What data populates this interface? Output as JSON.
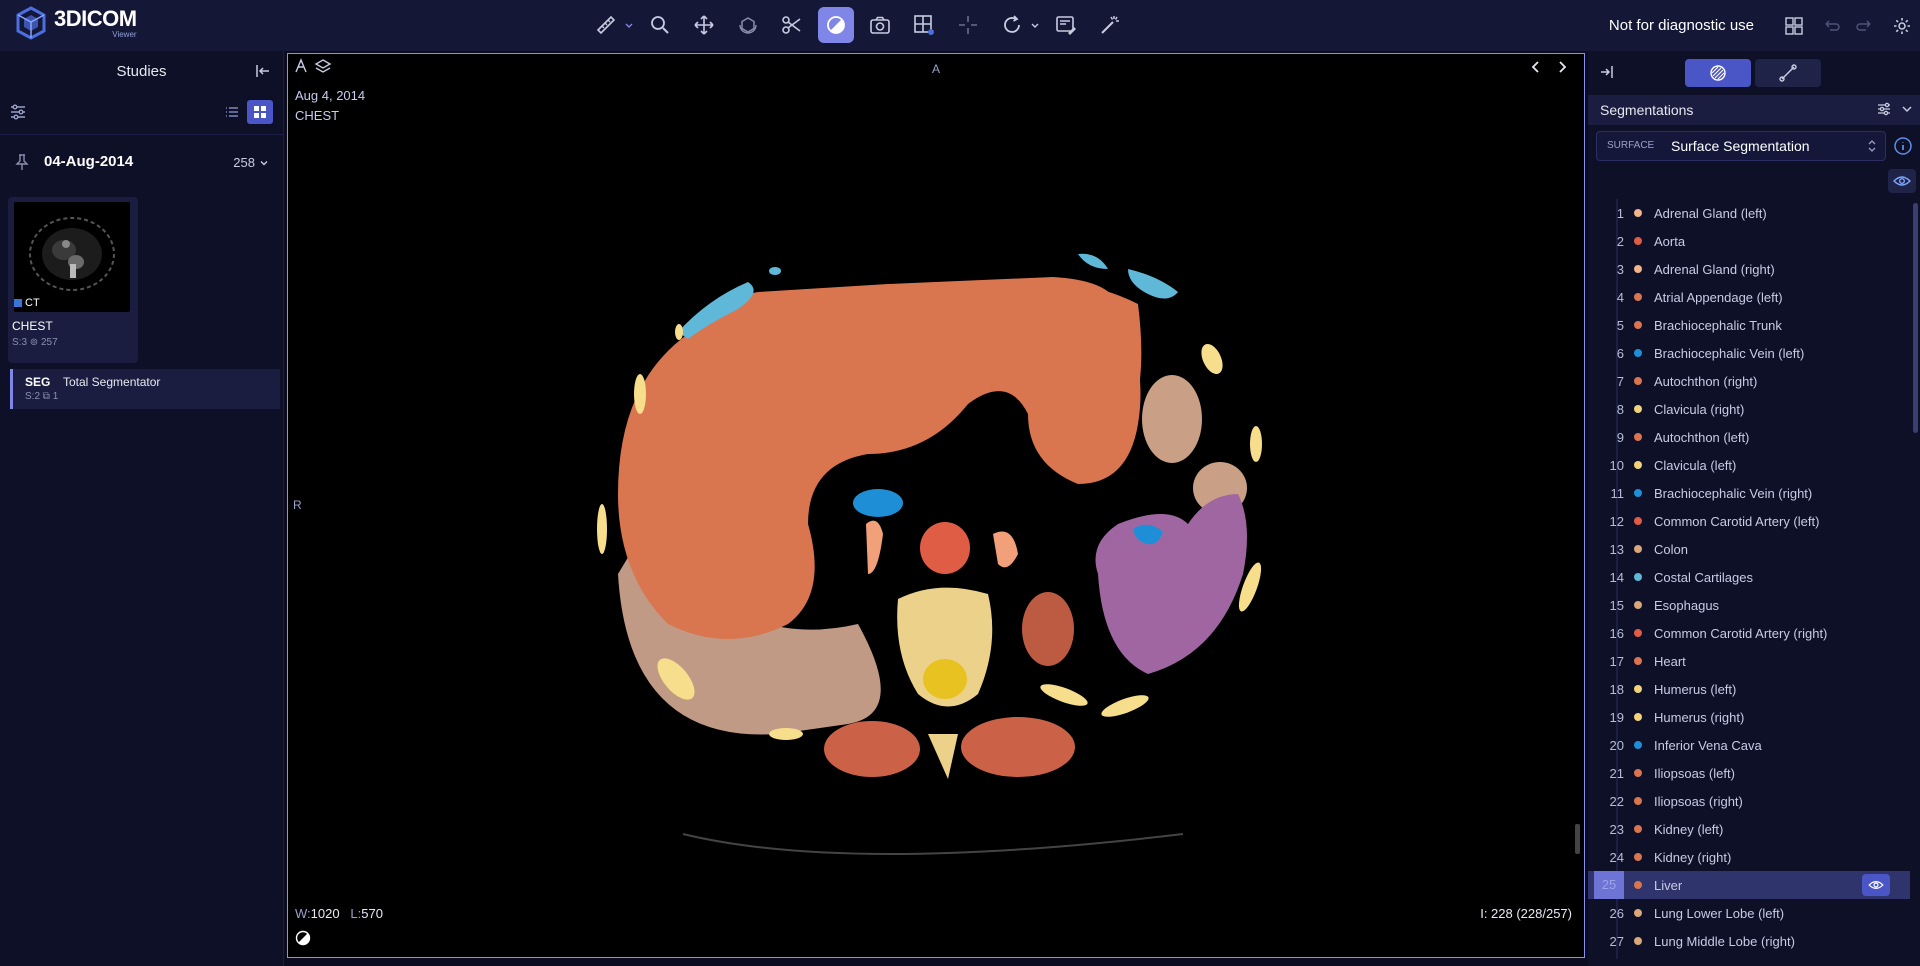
{
  "app": {
    "logo_name": "3DICOM",
    "logo_sub": "Viewer",
    "disclaimer": "Not for diagnostic use"
  },
  "toolbar": {
    "tools": [
      "ruler-tool",
      "zoom-tool",
      "pan-tool",
      "rotate-3d-tool",
      "scissors-tool",
      "segmentation-brush-tool",
      "screenshot-tool",
      "layout-tool",
      "crosshair-tool",
      "reset-rotate-tool",
      "report-tool",
      "magic-tool"
    ],
    "active_tool": "segmentation-brush-tool"
  },
  "studies": {
    "title": "Studies",
    "date": "04-Aug-2014",
    "image_count": "258",
    "series": {
      "modality": "CT",
      "name": "CHEST",
      "series_count": "S:3",
      "instances": "257"
    },
    "seg": {
      "tag": "SEG",
      "name": "Total Segmentator",
      "series_count": "S:2",
      "instances": "1"
    }
  },
  "viewport": {
    "date": "Aug 4, 2014",
    "description": "CHEST",
    "orient_top": "A",
    "orient_left": "R",
    "window_label": "W:",
    "window_value": "1020",
    "level_label": "L:",
    "level_value": "570",
    "image_index": "I: 228 (228/257)"
  },
  "segmentation_panel": {
    "title": "Segmentations",
    "type_tag": "SURFACE",
    "selected_segmentation": "Surface Segmentation",
    "selected_index": 25,
    "items": [
      {
        "num": "1",
        "name": "Adrenal Gland (left)",
        "color": "#f2b48a"
      },
      {
        "num": "2",
        "name": "Aorta",
        "color": "#e05d45"
      },
      {
        "num": "3",
        "name": "Adrenal Gland (right)",
        "color": "#f2b48a"
      },
      {
        "num": "4",
        "name": "Atrial Appendage (left)",
        "color": "#d9764f"
      },
      {
        "num": "5",
        "name": "Brachiocephalic Trunk",
        "color": "#d9764f"
      },
      {
        "num": "6",
        "name": "Brachiocephalic Vein (left)",
        "color": "#1e8fd6"
      },
      {
        "num": "7",
        "name": "Autochthon (right)",
        "color": "#d9764f"
      },
      {
        "num": "8",
        "name": "Clavicula (right)",
        "color": "#f2d27a"
      },
      {
        "num": "9",
        "name": "Autochthon (left)",
        "color": "#d9764f"
      },
      {
        "num": "10",
        "name": "Clavicula (left)",
        "color": "#f2d27a"
      },
      {
        "num": "11",
        "name": "Brachiocephalic Vein (right)",
        "color": "#1e8fd6"
      },
      {
        "num": "12",
        "name": "Common Carotid Artery (left)",
        "color": "#e05d45"
      },
      {
        "num": "13",
        "name": "Colon",
        "color": "#d9a77a"
      },
      {
        "num": "14",
        "name": "Costal Cartilages",
        "color": "#5fb8d8"
      },
      {
        "num": "15",
        "name": "Esophagus",
        "color": "#d9a77a"
      },
      {
        "num": "16",
        "name": "Common Carotid Artery (right)",
        "color": "#e05d45"
      },
      {
        "num": "17",
        "name": "Heart",
        "color": "#d9764f"
      },
      {
        "num": "18",
        "name": "Humerus (left)",
        "color": "#f2d27a"
      },
      {
        "num": "19",
        "name": "Humerus (right)",
        "color": "#f2d27a"
      },
      {
        "num": "20",
        "name": "Inferior Vena Cava",
        "color": "#1e8fd6"
      },
      {
        "num": "21",
        "name": "Iliopsoas (left)",
        "color": "#d9764f"
      },
      {
        "num": "22",
        "name": "Iliopsoas (right)",
        "color": "#d9764f"
      },
      {
        "num": "23",
        "name": "Kidney (left)",
        "color": "#d9764f"
      },
      {
        "num": "24",
        "name": "Kidney (right)",
        "color": "#d9764f"
      },
      {
        "num": "25",
        "name": "Liver",
        "color": "#d9764f"
      },
      {
        "num": "26",
        "name": "Lung Lower Lobe (left)",
        "color": "#d9a77a"
      },
      {
        "num": "27",
        "name": "Lung Middle Lobe (right)",
        "color": "#d9a77a"
      }
    ]
  }
}
